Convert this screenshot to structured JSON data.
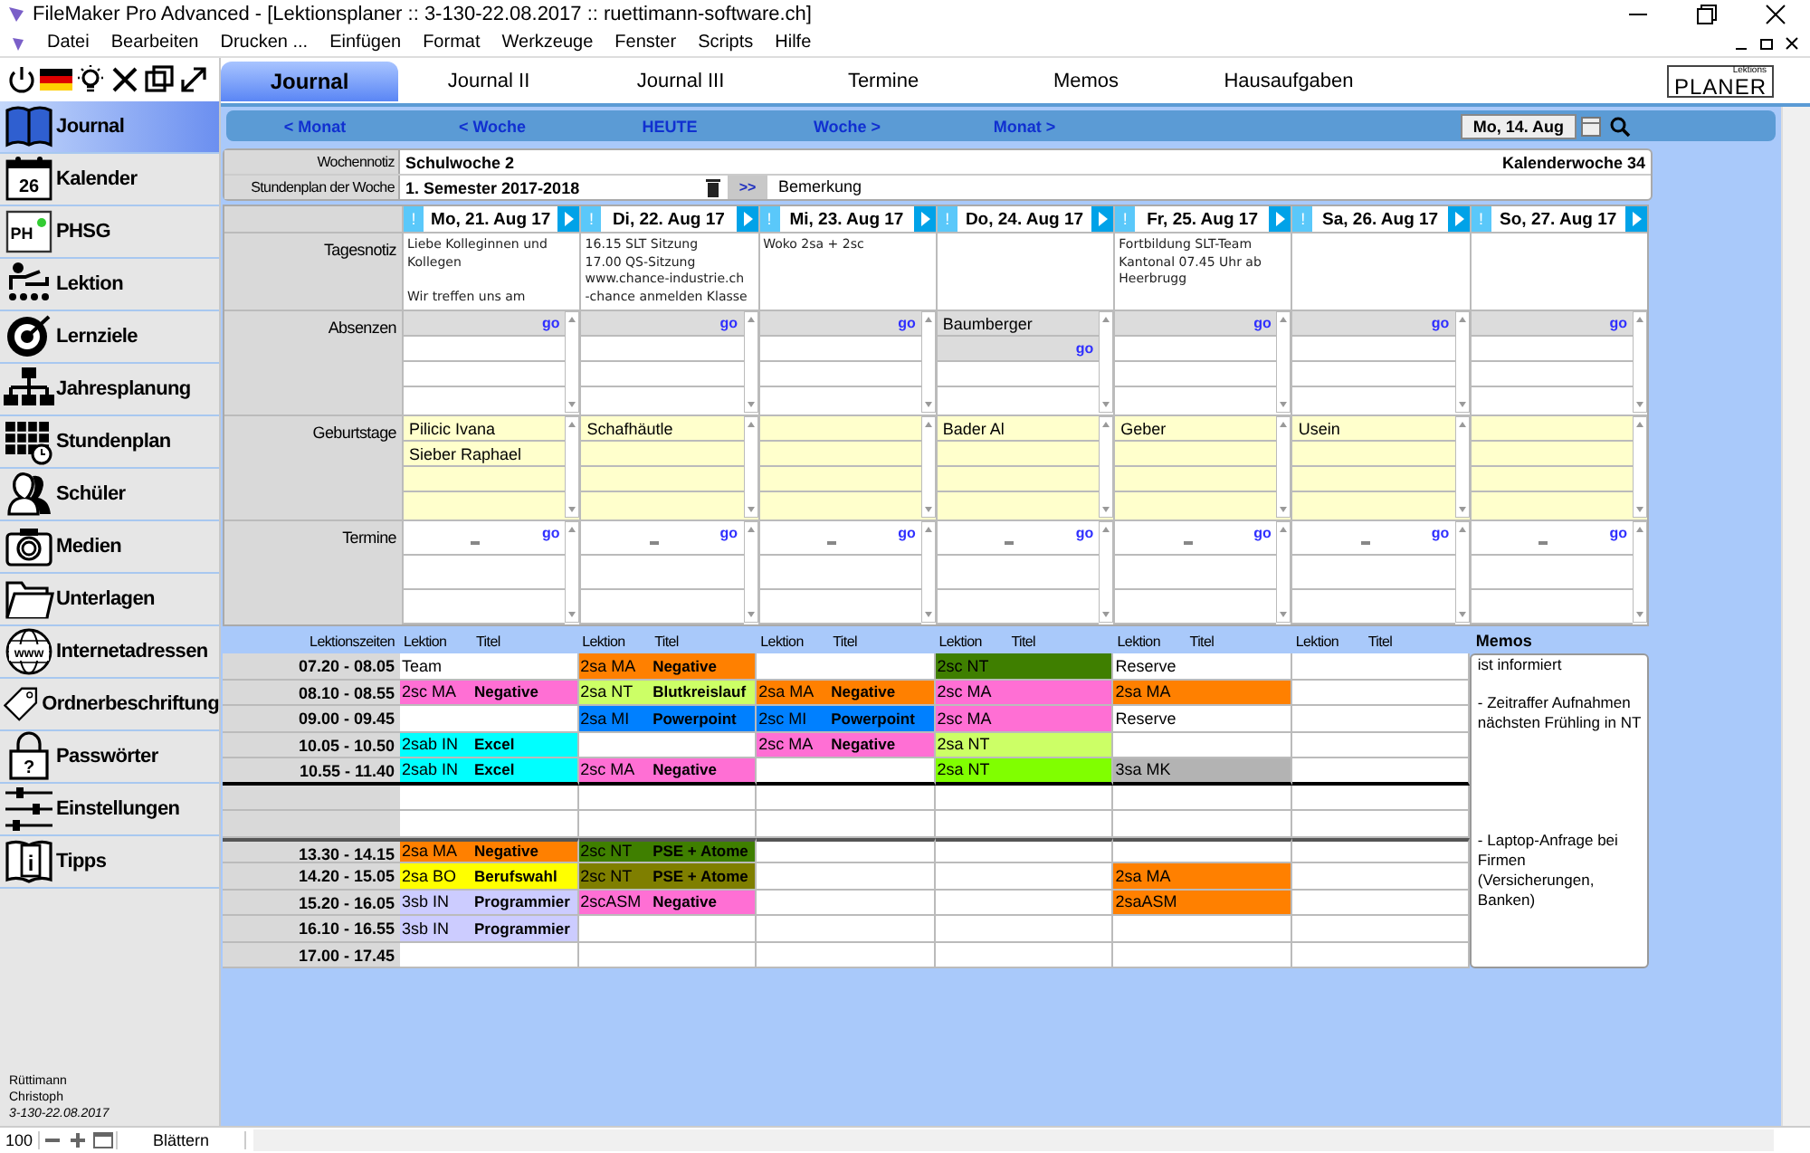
{
  "window": {
    "title": "FileMaker Pro Advanced - [Lektionsplaner :: 3-130-22.08.2017 :: ruettimann-software.ch]"
  },
  "menu": [
    "Datei",
    "Bearbeiten",
    "Drucken ...",
    "Einfügen",
    "Format",
    "Werkzeuge",
    "Fenster",
    "Scripts",
    "Hilfe"
  ],
  "tabs": [
    {
      "label": "Journal",
      "selected": true
    },
    {
      "label": "Journal II",
      "selected": false
    },
    {
      "label": "Journal III",
      "selected": false
    },
    {
      "label": "Termine",
      "selected": false
    },
    {
      "label": "Memos",
      "selected": false
    },
    {
      "label": "Hausaufgaben",
      "selected": false
    }
  ],
  "logo": {
    "small": "Lektions",
    "text": "PLANER"
  },
  "sidebar": {
    "items": [
      {
        "label": "Journal",
        "selected": true
      },
      {
        "label": "Kalender",
        "selected": false,
        "badge": "26"
      },
      {
        "label": "PHSG",
        "selected": false,
        "badge": "PH"
      },
      {
        "label": "Lektion",
        "selected": false
      },
      {
        "label": "Lernziele",
        "selected": false
      },
      {
        "label": "Jahresplanung",
        "selected": false
      },
      {
        "label": "Stundenplan",
        "selected": false
      },
      {
        "label": "Schüler",
        "selected": false
      },
      {
        "label": "Medien",
        "selected": false
      },
      {
        "label": "Unterlagen",
        "selected": false
      },
      {
        "label": "Internetadressen",
        "selected": false,
        "badge": "www"
      },
      {
        "label": "Ordnerbeschriftung",
        "selected": false
      },
      {
        "label": "Passwörter",
        "selected": false,
        "badge": "?"
      },
      {
        "label": "Einstellungen",
        "selected": false
      },
      {
        "label": "Tipps",
        "selected": false,
        "badge": "i"
      }
    ],
    "user": [
      "Rüttimann",
      "Christoph",
      "3-130-22.08.2017"
    ]
  },
  "nav": {
    "buttons": [
      "< Monat",
      "< Woche",
      "HEUTE",
      "Woche >",
      "Monat >"
    ],
    "date": "Mo, 14. Aug"
  },
  "week": {
    "note_label": "Wochennotiz",
    "note": "Schulwoche 2",
    "week_number": "Kalenderwoche 34",
    "plan_label": "Stundenplan der Woche",
    "plan": "1. Semester 2017-2018",
    "plan_button": ">>",
    "remark": "Bemerkung"
  },
  "row_labels": [
    "Tagesnotiz",
    "Absenzen",
    "Geburtstage",
    "Termine"
  ],
  "days": [
    {
      "flag": "!",
      "date": "Mo, 21. Aug 17",
      "note": "Liebe Kolleginnen und Kollegen\n\nWir treffen uns am",
      "absences": [
        {
          "link": "go"
        }
      ],
      "birthdays": [
        "Pilicic Ivana",
        "Sieber Raphael"
      ],
      "appointments": {
        "link": "go"
      }
    },
    {
      "flag": "!",
      "date": "Di, 22. Aug 17",
      "note": "16.15 SLT Sitzung\n17.00 QS-Sitzung\nwww.chance-industrie.ch\n-chance anmelden Klasse",
      "absences": [
        {
          "link": "go"
        }
      ],
      "birthdays": [
        "Schafhäutle"
      ],
      "appointments": {
        "link": "go"
      }
    },
    {
      "flag": "!",
      "date": "Mi, 23. Aug 17",
      "note": "Woko 2sa + 2sc",
      "absences": [
        {
          "link": "go"
        }
      ],
      "appointments": {
        "link": "go"
      }
    },
    {
      "flag": "!",
      "date": "Do, 24. Aug 17",
      "absences": [
        {
          "name": "Baumberger"
        },
        {
          "link": "go"
        }
      ],
      "birthdays": [
        "Bader Al"
      ],
      "appointments": {
        "link": "go"
      }
    },
    {
      "flag": "!",
      "date": "Fr, 25. Aug 17",
      "note": "Fortbildung SLT-Team Kantonal 07.45 Uhr ab Heerbrugg",
      "absences": [
        {
          "link": "go"
        }
      ],
      "birthdays": [
        "Geber"
      ],
      "appointments": {
        "link": "go"
      }
    },
    {
      "flag": "!",
      "date": "Sa, 26. Aug 17",
      "absences": [
        {
          "link": "go"
        }
      ],
      "birthdays": [
        "Usein"
      ],
      "appointments": {
        "link": "go"
      }
    },
    {
      "flag": "!",
      "date": "So, 27. Aug 17",
      "absences": [
        {
          "link": "go"
        }
      ],
      "appointments": {
        "link": "go"
      }
    }
  ],
  "lessons": {
    "time_header": "Lektionszeiten",
    "columns": [
      {
        "lesson": "Lektion",
        "title": "Titel"
      },
      {
        "lesson": "Lektion",
        "title": "Titel"
      },
      {
        "lesson": "Lektion",
        "title": "Titel"
      },
      {
        "lesson": "Lektion",
        "title": "Titel"
      },
      {
        "lesson": "Lektion",
        "title": "Titel"
      },
      {
        "lesson": "Lektion",
        "title": "Titel"
      }
    ],
    "slots": [
      {
        "kind": "lesson",
        "time": "07.20 - 08.05",
        "cells": [
          {
            "lesson": "Team"
          },
          {
            "lesson": "2sa MA",
            "title": "Negative",
            "color": "#ff8000"
          },
          null,
          {
            "lesson": "2sc NT",
            "color": "#3f7f00"
          },
          {
            "lesson": "Reserve"
          },
          null
        ]
      },
      {
        "kind": "lesson",
        "time": "08.10 - 08.55",
        "cells": [
          {
            "lesson": "2sc MA",
            "title": "Negative",
            "color": "#ff6fd4"
          },
          {
            "lesson": "2sa NT",
            "title": "Blutkreislauf",
            "color": "#ccff66"
          },
          {
            "lesson": "2sa MA",
            "title": "Negative",
            "color": "#ff8000"
          },
          {
            "lesson": "2sc MA",
            "color": "#ff6fd4"
          },
          {
            "lesson": "2sa MA",
            "color": "#ff8000"
          },
          null
        ]
      },
      {
        "kind": "lesson",
        "time": "09.00 - 09.45",
        "cells": [
          null,
          {
            "lesson": "2sa MI",
            "title": "Powerpoint",
            "color": "#0080ff"
          },
          {
            "lesson": "2sc MI",
            "title": "Powerpoint",
            "color": "#0080ff"
          },
          {
            "lesson": "2sc MA",
            "color": "#ff6fd4"
          },
          {
            "lesson": "Reserve"
          },
          null
        ]
      },
      {
        "kind": "lesson",
        "time": "10.05 - 10.50",
        "cells": [
          {
            "lesson": "2sab IN",
            "title": "Excel",
            "color": "#00ffff"
          },
          null,
          {
            "lesson": "2sc MA",
            "title": "Negative",
            "color": "#ff6fd4"
          },
          {
            "lesson": "2sa NT",
            "color": "#ccff66"
          },
          null,
          null
        ]
      },
      {
        "kind": "lesson",
        "time": "10.55 - 11.40",
        "cells": [
          {
            "lesson": "2sab IN",
            "title": "Excel",
            "color": "#00ffff"
          },
          {
            "lesson": "2sc MA",
            "title": "Negative",
            "color": "#ff6fd4"
          },
          null,
          {
            "lesson": "2sa NT",
            "color": "#80ff00"
          },
          {
            "lesson": "3sa MK",
            "color": "#b3b3b3"
          },
          null
        ]
      },
      {
        "kind": "break"
      },
      {
        "kind": "break"
      },
      {
        "kind": "lesson",
        "time": "13.30 - 14.15",
        "cells": [
          {
            "lesson": "2sa MA",
            "title": "Negative",
            "color": "#ff8000"
          },
          {
            "lesson": "2sc NT",
            "title": "PSE + Atome",
            "color": "#3f7f00"
          },
          null,
          null,
          null,
          null
        ]
      },
      {
        "kind": "lesson",
        "time": "14.20 - 15.05",
        "cells": [
          {
            "lesson": "2sa BO",
            "title": "Berufswahl",
            "color": "#ffff00"
          },
          {
            "lesson": "2sc NT",
            "title": "PSE + Atome",
            "color": "#7f7f00"
          },
          null,
          null,
          {
            "lesson": "2sa MA",
            "color": "#ff8000"
          },
          null
        ]
      },
      {
        "kind": "lesson",
        "time": "15.20 - 16.05",
        "cells": [
          {
            "lesson": "3sb IN",
            "title": "Programmier",
            "color": "#ccccff"
          },
          {
            "lesson": "2scASM",
            "title": "Negative",
            "color": "#ff6fd4"
          },
          null,
          null,
          {
            "lesson": "2saASM",
            "color": "#ff8000"
          },
          null
        ]
      },
      {
        "kind": "lesson",
        "time": "16.10 - 16.55",
        "cells": [
          {
            "lesson": "3sb IN",
            "title": "Programmier",
            "color": "#ccccff"
          },
          null,
          null,
          null,
          null,
          null
        ]
      },
      {
        "kind": "lesson",
        "time": "17.00 - 17.45",
        "cells": [
          null,
          null,
          null,
          null,
          null,
          null
        ]
      }
    ]
  },
  "memos": {
    "title": "Memos",
    "entries": [
      "ist informiert",
      "- Zeitraffer Aufnahmen nächsten Frühling in NT",
      "- Laptop-Anfrage bei Firmen (Versicherungen, Banken)"
    ]
  },
  "status_bar": {
    "zoom": "100",
    "mode": "Blättern"
  }
}
